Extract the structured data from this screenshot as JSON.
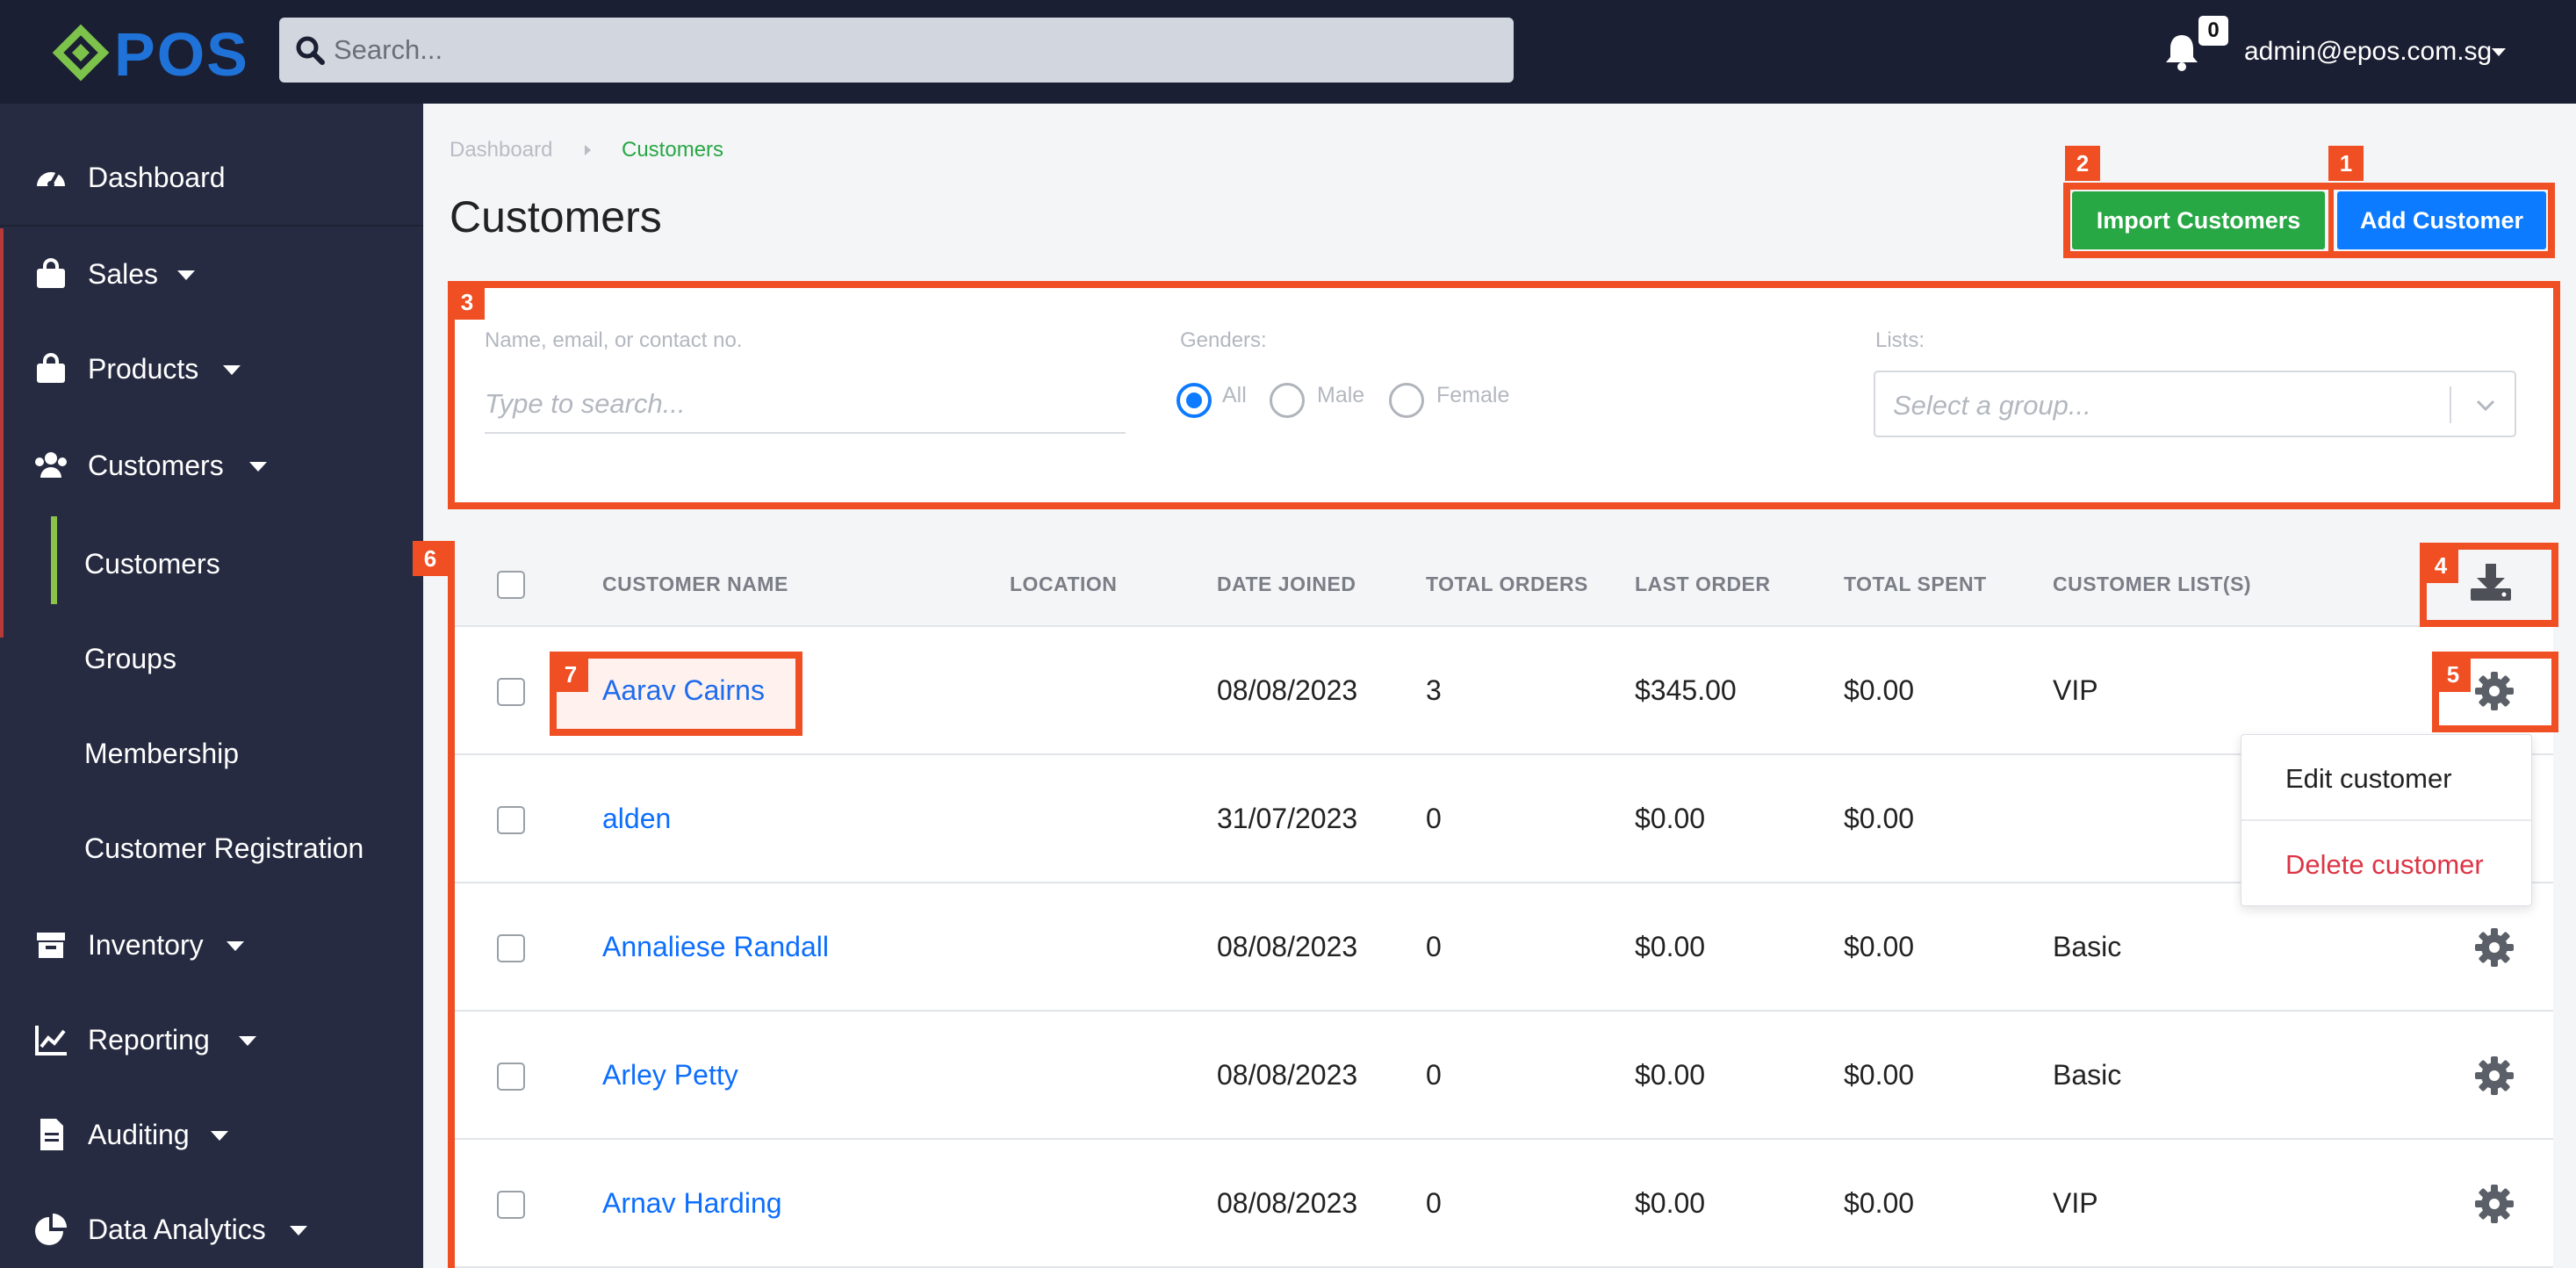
{
  "header": {
    "logo_text": "ePOS",
    "search_placeholder": "Search...",
    "notification_count": "0",
    "user_email": "admin@epos.com.sg"
  },
  "sidebar": {
    "items": [
      {
        "label": "Dashboard",
        "icon": "gauge-icon"
      },
      {
        "label": "Sales",
        "icon": "shopping-bag-icon"
      },
      {
        "label": "Products",
        "icon": "shopping-bag-icon"
      },
      {
        "label": "Customers",
        "icon": "users-icon"
      },
      {
        "label": "Inventory",
        "icon": "archive-box-icon"
      },
      {
        "label": "Reporting",
        "icon": "line-chart-icon"
      },
      {
        "label": "Auditing",
        "icon": "document-icon"
      },
      {
        "label": "Data Analytics",
        "icon": "pie-chart-icon"
      }
    ],
    "customers_sub": [
      "Customers",
      "Groups",
      "Membership",
      "Customer Registration"
    ],
    "accent_color": "#8bc34a"
  },
  "breadcrumb": {
    "root": "Dashboard",
    "current": "Customers"
  },
  "page": {
    "title": "Customers",
    "import_button": "Import Customers",
    "add_button": "Add Customer"
  },
  "filters": {
    "search_label": "Name, email, or contact no.",
    "search_placeholder": "Type to search...",
    "genders_label": "Genders:",
    "genders": [
      "All",
      "Male",
      "Female"
    ],
    "genders_selected": "All",
    "lists_label": "Lists:",
    "lists_placeholder": "Select a group..."
  },
  "table": {
    "columns": [
      "CUSTOMER NAME",
      "LOCATION",
      "DATE JOINED",
      "TOTAL ORDERS",
      "LAST ORDER",
      "TOTAL SPENT",
      "CUSTOMER LIST(S)"
    ],
    "rows": [
      {
        "name": "Aarav Cairns",
        "location": "",
        "date_joined": "08/08/2023",
        "total_orders": "3",
        "last_order": "$345.00",
        "total_spent": "$0.00",
        "lists": "VIP"
      },
      {
        "name": "alden",
        "location": "",
        "date_joined": "31/07/2023",
        "total_orders": "0",
        "last_order": "$0.00",
        "total_spent": "$0.00",
        "lists": ""
      },
      {
        "name": "Annaliese Randall",
        "location": "",
        "date_joined": "08/08/2023",
        "total_orders": "0",
        "last_order": "$0.00",
        "total_spent": "$0.00",
        "lists": "Basic"
      },
      {
        "name": "Arley Petty",
        "location": "",
        "date_joined": "08/08/2023",
        "total_orders": "0",
        "last_order": "$0.00",
        "total_spent": "$0.00",
        "lists": "Basic"
      },
      {
        "name": "Arnav Harding",
        "location": "",
        "date_joined": "08/08/2023",
        "total_orders": "0",
        "last_order": "$0.00",
        "total_spent": "$0.00",
        "lists": "VIP"
      }
    ]
  },
  "row_menu": {
    "edit": "Edit customer",
    "delete": "Delete customer"
  },
  "annotations": [
    "1",
    "2",
    "3",
    "4",
    "5",
    "6",
    "7"
  ],
  "colors": {
    "topbar": "#1b1f33",
    "sidebar": "#262b41",
    "primary": "#0d7bff",
    "success": "#28a745",
    "danger": "#dc3545",
    "annotation": "#f04e23"
  }
}
